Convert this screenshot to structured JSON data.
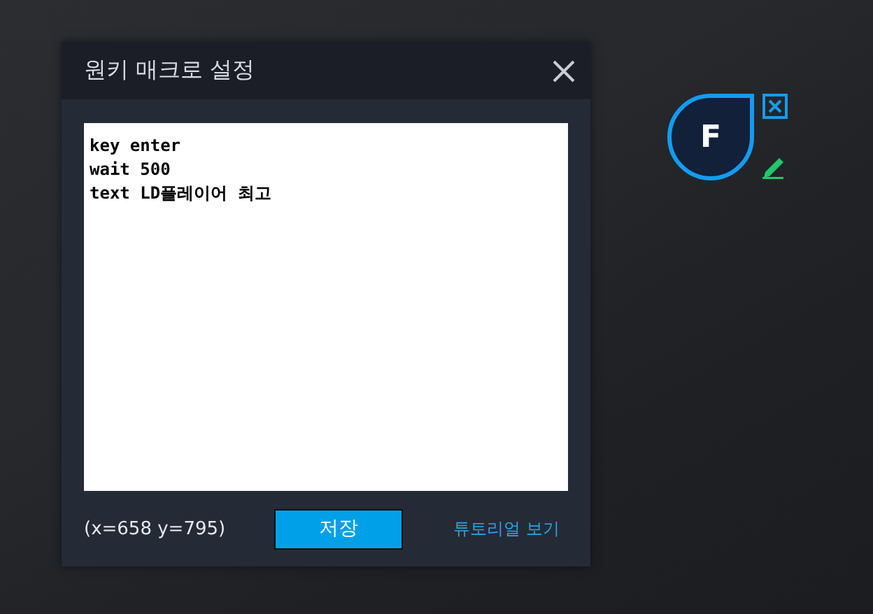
{
  "dialog": {
    "title": "원키 매크로 설정",
    "editor_lines": [
      "key enter",
      "wait 500",
      "text LD플레이어 최고"
    ],
    "coordinates": "(x=658  y=795)",
    "save_button": "저장",
    "tutorial_link": "튜토리얼 보기"
  },
  "key_marker": {
    "label": "F"
  }
}
